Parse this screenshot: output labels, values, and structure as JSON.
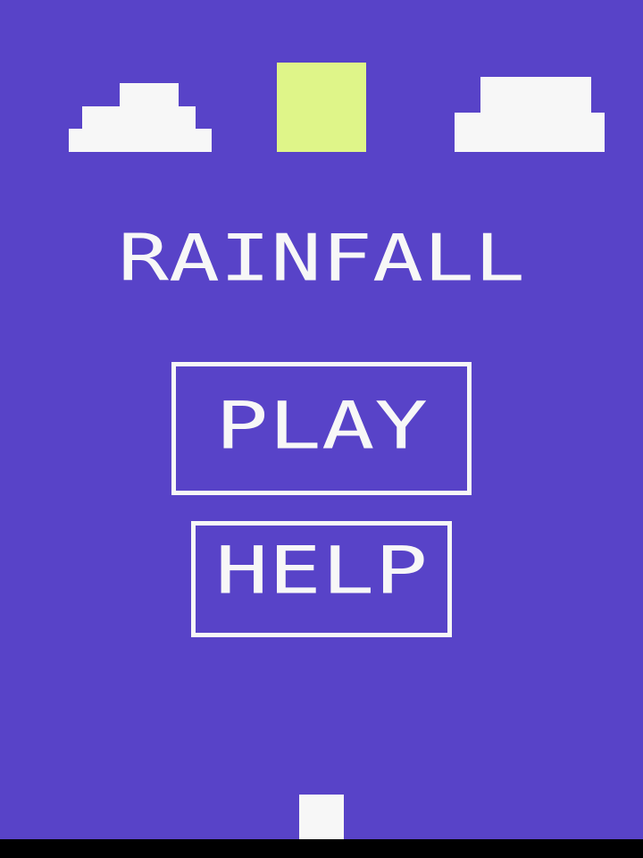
{
  "game": {
    "title": "RAINFALL",
    "menu": {
      "play_label": "PLAY",
      "help_label": "HELP"
    }
  },
  "colors": {
    "background": "#5843C8",
    "foreground": "#F7F7F7",
    "accent_block": "#DFF589",
    "bottom_bar": "#000000"
  }
}
